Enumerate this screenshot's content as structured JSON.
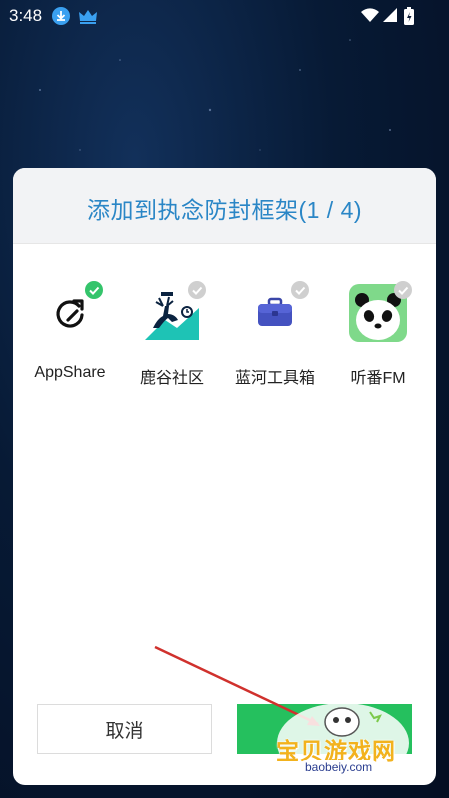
{
  "status_bar": {
    "time": "3:48",
    "icons": [
      "download-icon",
      "crown-icon",
      "wifi-icon",
      "signal-icon",
      "battery-icon"
    ]
  },
  "dialog": {
    "title": "添加到执念防封框架(1 / 4)",
    "apps": [
      {
        "label": "AppShare",
        "icon": "appshare-icon",
        "checked": true
      },
      {
        "label": "鹿谷社区",
        "icon": "deer-valley-icon",
        "checked": false
      },
      {
        "label": "蓝河工具箱",
        "icon": "toolbox-icon",
        "checked": false
      },
      {
        "label": "听番FM",
        "icon": "panda-icon",
        "checked": false
      }
    ],
    "cancel_label": "取消",
    "confirm_label": ""
  },
  "watermark": {
    "text": "宝贝游戏网",
    "url": "baobeiy.com"
  },
  "colors": {
    "title": "#2a86c6",
    "confirm": "#25c05e",
    "check_on": "#34c46b",
    "check_off": "#cfcfcf",
    "annotation_arrow": "#d0312d"
  }
}
